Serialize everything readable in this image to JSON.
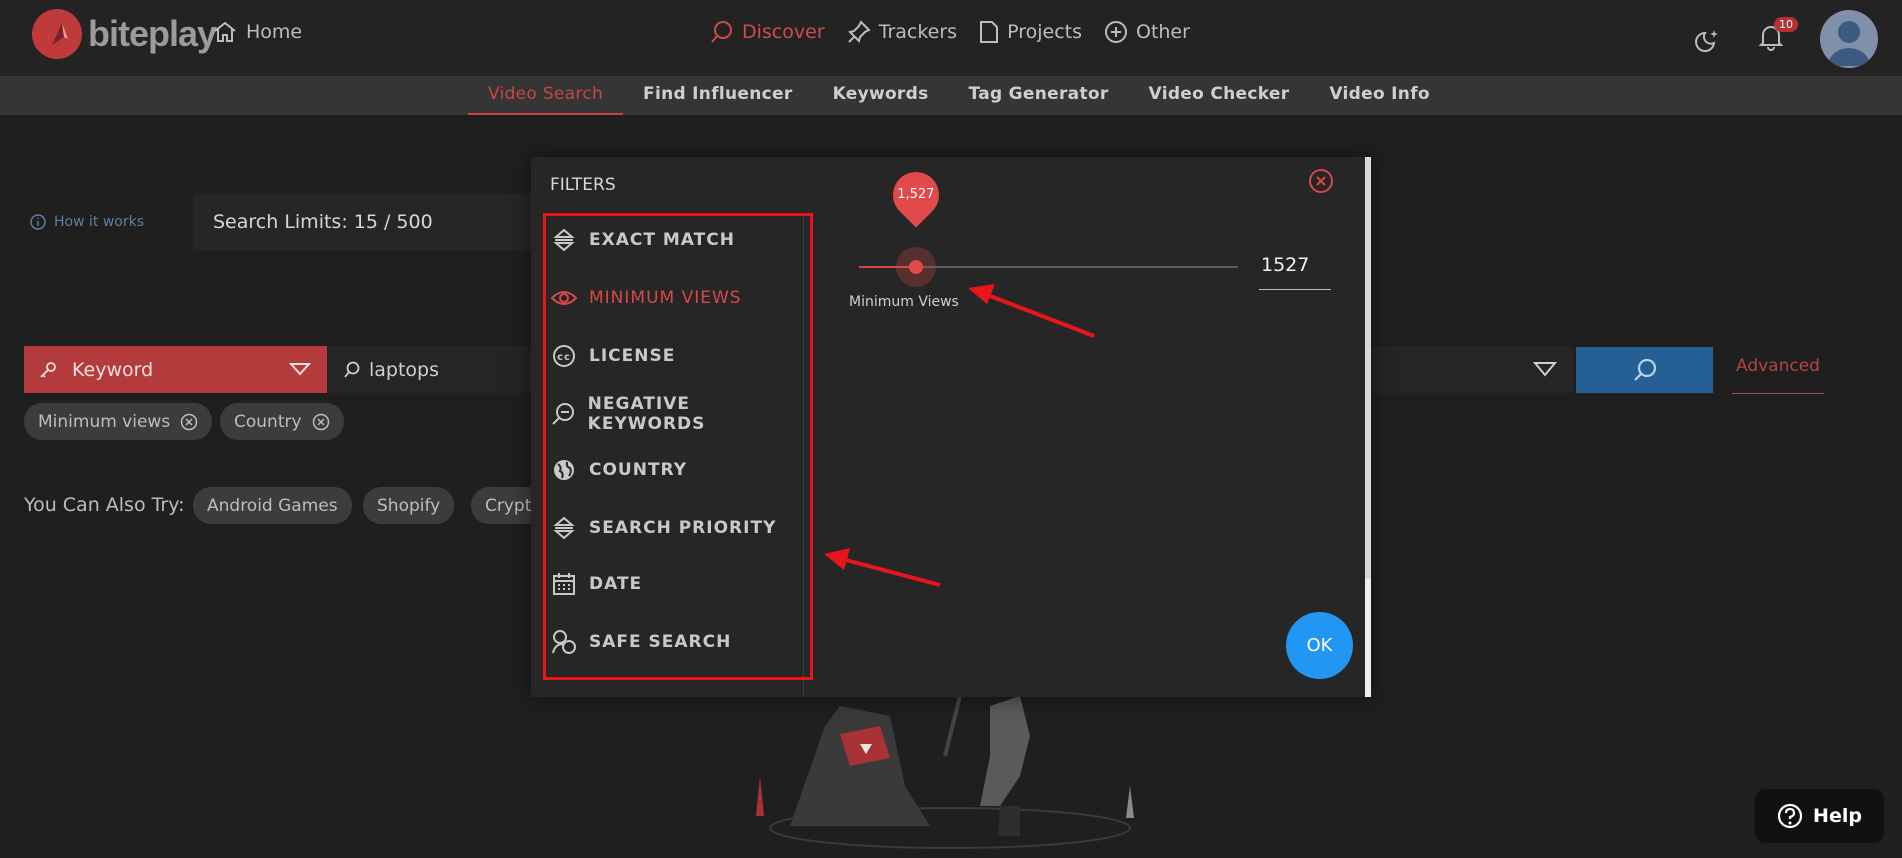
{
  "brand": {
    "name": "biteplay"
  },
  "nav": {
    "home": "Home",
    "items": [
      {
        "label": "Discover",
        "icon": "search-icon",
        "active": true
      },
      {
        "label": "Trackers",
        "icon": "pin-icon",
        "active": false
      },
      {
        "label": "Projects",
        "icon": "document-icon",
        "active": false
      },
      {
        "label": "Other",
        "icon": "plus-circle-icon",
        "active": false
      }
    ],
    "notifications": "10"
  },
  "subnav": {
    "tabs": [
      {
        "label": "Video Search",
        "active": true
      },
      {
        "label": "Find Influencer"
      },
      {
        "label": "Keywords"
      },
      {
        "label": "Tag Generator"
      },
      {
        "label": "Video Checker"
      },
      {
        "label": "Video Info"
      }
    ]
  },
  "page": {
    "how_it_works": "How it works",
    "search_limits": "Search Limits: 15 / 500",
    "search_type": "Keyword",
    "search_value": "laptops",
    "advanced": "Advanced",
    "active_filters": [
      "Minimum views",
      "Country"
    ],
    "try_label": "You Can Also Try:",
    "suggestions": [
      "Android Games",
      "Shopify",
      "Crypt"
    ]
  },
  "modal": {
    "title": "FILTERS",
    "filters": [
      {
        "label": "EXACT MATCH",
        "icon": "sort-arrows-icon"
      },
      {
        "label": "MINIMUM VIEWS",
        "icon": "eye-icon",
        "active": true
      },
      {
        "label": "LICENSE",
        "icon": "cc-icon"
      },
      {
        "label": "NEGATIVE KEYWORDS",
        "icon": "minus-search-icon"
      },
      {
        "label": "COUNTRY",
        "icon": "globe-icon"
      },
      {
        "label": "SEARCH PRIORITY",
        "icon": "sort-arrows-icon"
      },
      {
        "label": "DATE",
        "icon": "calendar-icon"
      },
      {
        "label": "SAFE SEARCH",
        "icon": "safe-search-icon"
      }
    ],
    "slider": {
      "bubble": "1,527",
      "label": "Minimum Views",
      "value": "1527",
      "fraction": 0.15
    },
    "ok": "OK"
  },
  "help": {
    "label": "Help"
  },
  "colors": {
    "accent": "#d74848",
    "primary_blue": "#2196f3",
    "annotation_red": "#e8161c"
  }
}
